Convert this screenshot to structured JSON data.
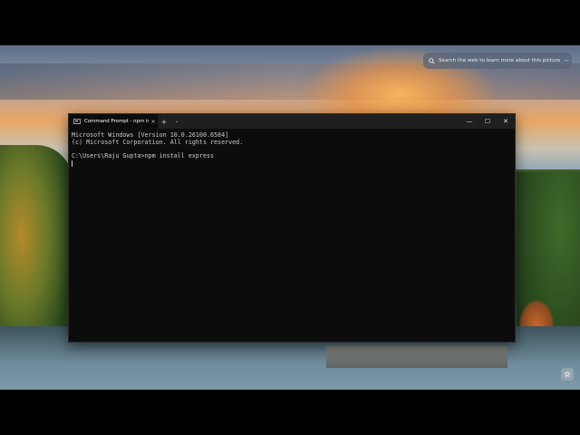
{
  "desktop": {
    "search_hint": {
      "text": "Search the web to learn more about this picture",
      "icon": "search-icon",
      "more_label": "···"
    }
  },
  "terminal": {
    "tab": {
      "icon": "command-prompt-icon",
      "title": "Command Prompt - npm  insl",
      "close_label": "×"
    },
    "new_tab_label": "+",
    "dropdown_label": "⌄",
    "window_controls": {
      "minimize": "—",
      "maximize": "☐",
      "close": "✕"
    },
    "lines": [
      "Microsoft Windows [Version 10.0.26100.6584]",
      "(c) Microsoft Corporation. All rights reserved.",
      "",
      "C:\\Users\\Raju Gupta>npm install express"
    ]
  },
  "colors": {
    "console_bg": "#0c0c0c",
    "titlebar_bg": "#1f1f1f",
    "console_text": "#cccccc"
  }
}
